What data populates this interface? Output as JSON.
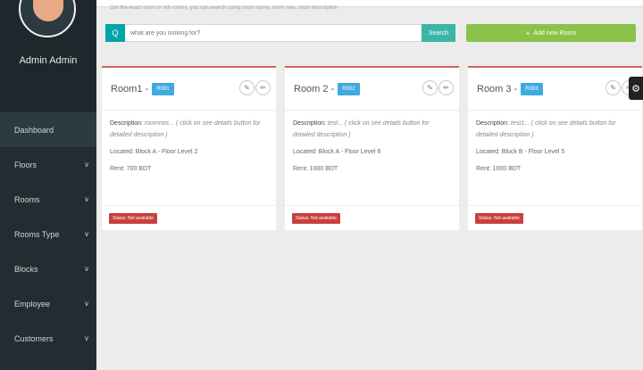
{
  "profile": {
    "name": "Admin Admin"
  },
  "sidebar": {
    "items": [
      {
        "label": "Dashboard",
        "chevron": ""
      },
      {
        "label": "Floors",
        "chevron": "∨"
      },
      {
        "label": "Rooms",
        "chevron": "∨"
      },
      {
        "label": "Rooms Type",
        "chevron": "∨"
      },
      {
        "label": "Blocks",
        "chevron": "∨"
      },
      {
        "label": "Employee",
        "chevron": "∨"
      },
      {
        "label": "Customers",
        "chevron": "∨"
      }
    ]
  },
  "search": {
    "hint": "Get the exact room or nth rooms, you can search using room name, room rate, room description",
    "icon": "Q",
    "placeholder": "what are you looking for?",
    "button_label": "Search"
  },
  "add_room": {
    "icon": "+",
    "label": "Add new Room"
  },
  "rooms": [
    {
      "name": "Room1 -",
      "code": "R001",
      "description_label": "Description:",
      "description_text": "roomnos... ( click on see details button for detailed description )",
      "located": "Located: Block A - Floor Level 2",
      "rent": "Rent: 700 BDT",
      "status": "Status: Not available"
    },
    {
      "name": "Room 2 -",
      "code": "R002",
      "description_label": "Description:",
      "description_text": "test... ( click on see details button for detailed description )",
      "located": "Located: Block A - Floor Level 6",
      "rent": "Rent: 1000 BDT",
      "status": "Status: Not available"
    },
    {
      "name": "Room 3 -",
      "code": "R003",
      "description_label": "Description:",
      "description_text": "test1... ( click on see details button for detailed description )",
      "located": "Located: Block B - Floor Level 5",
      "rent": "Rent: 1000 BDT",
      "status": "Status: Not available"
    }
  ],
  "icons": {
    "edit": "edit-icon",
    "delete": "pencil-icon",
    "settings": "gear-icon"
  },
  "colors": {
    "sidebar": "#222d32",
    "search_icon": "#00a5a8",
    "add_button": "#8bc34a",
    "badge": "#3fa9e0",
    "status": "#c9403e"
  }
}
